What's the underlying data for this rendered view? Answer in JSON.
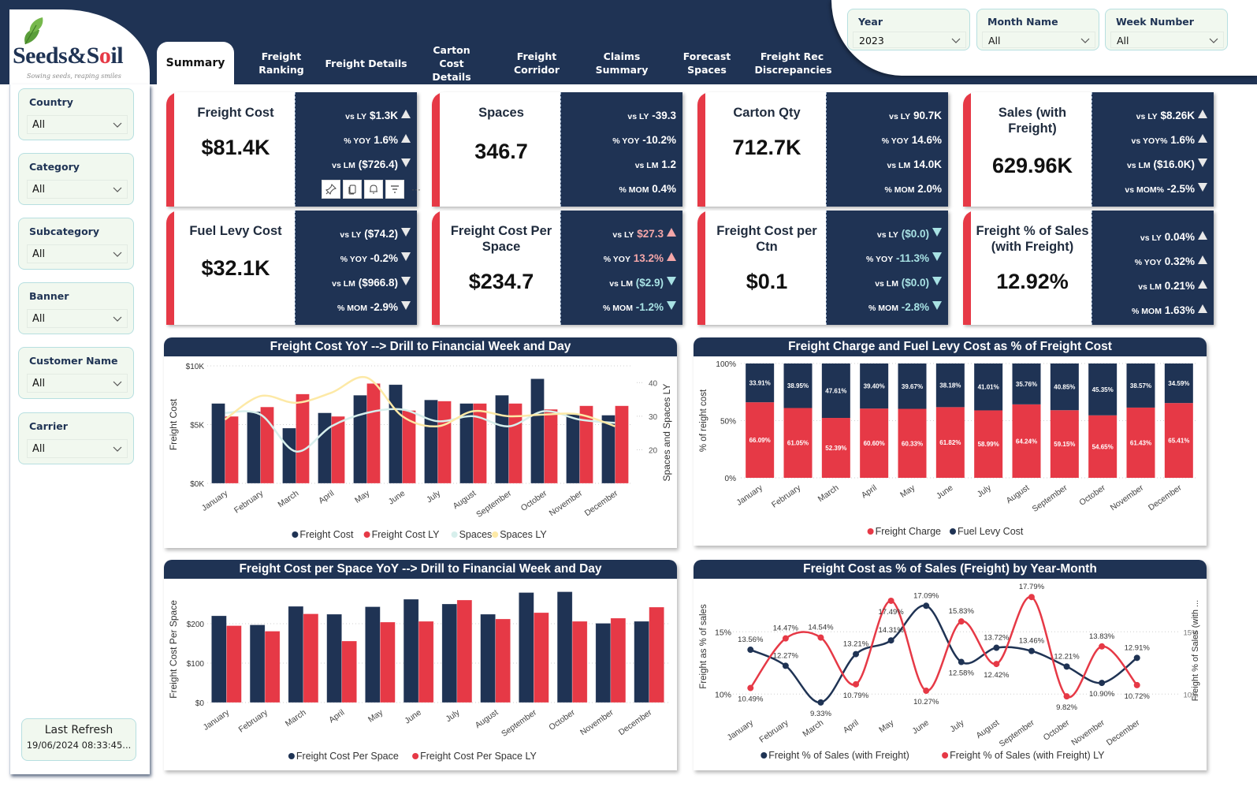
{
  "brand": {
    "name_part1": "Seeds&S",
    "name_o": "o",
    "name_part2": "il",
    "tagline": "Sowing seeds, reaping smiles"
  },
  "colors": {
    "navy": "#1f3354",
    "red": "#e63946",
    "mint": "#f1f8ef",
    "spaces": "#d7efec",
    "spaces_ly": "#fde9a6",
    "pink_up": "#f4a6a8",
    "teal_down": "#a8e2e4"
  },
  "tabs": [
    {
      "label": "Summary",
      "active": true
    },
    {
      "label": "Freight Ranking"
    },
    {
      "label": "Freight Details"
    },
    {
      "label": "Carton Cost Details"
    },
    {
      "label": "Freight Corridor"
    },
    {
      "label": "Claims Summary"
    },
    {
      "label": "Forecast Spaces"
    },
    {
      "label": "Freight Rec Discrepancies"
    }
  ],
  "header_filters": [
    {
      "label": "Year",
      "value": "2023"
    },
    {
      "label": "Month Name",
      "value": "All"
    },
    {
      "label": "Week Number",
      "value": "All"
    }
  ],
  "sidebar_filters": [
    {
      "label": "Country",
      "value": "All"
    },
    {
      "label": "Category",
      "value": "All"
    },
    {
      "label": "Subcategory",
      "value": "All"
    },
    {
      "label": "Banner",
      "value": "All"
    },
    {
      "label": "Customer Name",
      "value": "All"
    },
    {
      "label": "Carrier",
      "value": "All"
    }
  ],
  "last_refresh": {
    "label": "Last Refresh",
    "value": "19/06/2024 08:33:45..."
  },
  "visual_toolbar": {
    "icons": [
      "pin-icon",
      "copy-icon",
      "bell-icon",
      "filter-icon",
      "more-options-icon"
    ],
    "more": "···"
  },
  "kpis": [
    {
      "title": "Freight Cost",
      "value": "$81.4K",
      "rows": [
        {
          "pre": "vs LY",
          "val": "$1.3K",
          "arrow": "up"
        },
        {
          "pre": "% YOY",
          "val": "1.6%",
          "arrow": "up"
        },
        {
          "pre": "vs LM",
          "val": "($726.4)",
          "arrow": "down"
        }
      ]
    },
    {
      "title": "Spaces",
      "value": "346.7",
      "rows": [
        {
          "pre": "vs LY",
          "val": "-39.3"
        },
        {
          "pre": "% YOY",
          "val": "-10.2%"
        },
        {
          "pre": "vs LM",
          "val": "1.2"
        },
        {
          "pre": "% MOM",
          "val": "0.4%"
        }
      ]
    },
    {
      "title": "Carton Qty",
      "value": "712.7K",
      "rows": [
        {
          "pre": "vs LY",
          "val": "90.7K"
        },
        {
          "pre": "% YOY",
          "val": "14.6%"
        },
        {
          "pre": "vs LM",
          "val": "14.0K"
        },
        {
          "pre": "% MOM",
          "val": "2.0%"
        }
      ]
    },
    {
      "title": "Sales (with Freight)",
      "value": "629.96K",
      "rows": [
        {
          "pre": "vs LY",
          "val": "$8.26K",
          "arrow": "up"
        },
        {
          "pre": "vs YOY%",
          "val": "1.6%",
          "arrow": "up"
        },
        {
          "pre": "vs LM",
          "val": "($16.0K)",
          "arrow": "down"
        },
        {
          "pre": "vs MOM%",
          "val": "-2.5%",
          "arrow": "down"
        }
      ]
    },
    {
      "title": "Fuel Levy Cost",
      "value": "$32.1K",
      "rows": [
        {
          "pre": "vs LY",
          "val": "($74.2)",
          "arrow": "down"
        },
        {
          "pre": "% YOY",
          "val": "-0.2%",
          "arrow": "down"
        },
        {
          "pre": "vs LM",
          "val": "($966.8)",
          "arrow": "down"
        },
        {
          "pre": "% MOM",
          "val": "-2.9%",
          "arrow": "down"
        }
      ]
    },
    {
      "title": "Freight Cost Per Space",
      "value": "$234.7",
      "rows": [
        {
          "pre": "vs LY",
          "val": "$27.3",
          "arrow": "up",
          "tone": "pink"
        },
        {
          "pre": "% YOY",
          "val": "13.2%",
          "arrow": "up",
          "tone": "pink"
        },
        {
          "pre": "vs LM",
          "val": "($2.9)",
          "arrow": "down",
          "tone": "teal"
        },
        {
          "pre": "% MOM",
          "val": "-1.2%",
          "arrow": "down",
          "tone": "teal"
        }
      ]
    },
    {
      "title": "Freight Cost per Ctn",
      "value": "$0.1",
      "rows": [
        {
          "pre": "vs LY",
          "val": "($0.0)",
          "arrow": "down",
          "tone": "teal"
        },
        {
          "pre": "% YOY",
          "val": "-11.3%",
          "arrow": "down",
          "tone": "teal"
        },
        {
          "pre": "vs LM",
          "val": "($0.0)",
          "arrow": "down",
          "tone": "teal"
        },
        {
          "pre": "% MOM",
          "val": "-2.8%",
          "arrow": "down",
          "tone": "teal"
        }
      ]
    },
    {
      "title": "Freight % of Sales (with Freight)",
      "value": "12.92%",
      "rows": [
        {
          "pre": "vs LY",
          "val": "0.04%",
          "arrow": "up"
        },
        {
          "pre": "% YOY",
          "val": "0.32%",
          "arrow": "up"
        },
        {
          "pre": "vs LM",
          "val": "0.21%",
          "arrow": "up"
        },
        {
          "pre": "% MOM",
          "val": "1.63%",
          "arrow": "up"
        }
      ]
    }
  ],
  "chart_data": [
    {
      "id": "freight-cost-yoy",
      "type": "bar",
      "title": "Freight Cost YoY --> Drill to Financial Week and Day",
      "categories": [
        "January",
        "February",
        "March",
        "April",
        "May",
        "June",
        "July",
        "August",
        "September",
        "October",
        "November",
        "December"
      ],
      "ylabel": "Freight Cost",
      "y2label": "Spaces and Spaces LY",
      "ylim": [
        0,
        10000
      ],
      "y2lim": [
        10,
        45
      ],
      "yticks": [
        "$0K",
        "$5K",
        "$10K"
      ],
      "y2ticks": [
        "20",
        "30",
        "40"
      ],
      "series": [
        {
          "name": "Freight Cost",
          "kind": "bar",
          "color": "#1f3354",
          "values": [
            6800,
            6100,
            4700,
            6000,
            7500,
            8400,
            7100,
            6800,
            7500,
            8900,
            5900,
            5800
          ]
        },
        {
          "name": "Freight Cost LY",
          "kind": "bar",
          "color": "#e63946",
          "values": [
            5700,
            6500,
            7600,
            5700,
            8500,
            6200,
            7000,
            6800,
            6800,
            6300,
            6600,
            6600
          ]
        },
        {
          "name": "Spaces",
          "kind": "line",
          "axis": "y2",
          "color": "#d7efec",
          "values": [
            31,
            30.5,
            19.5,
            27,
            31,
            32,
            28.5,
            30,
            27,
            31.5,
            29,
            28
          ]
        },
        {
          "name": "Spaces LY",
          "kind": "line",
          "axis": "y2",
          "color": "#fde9a6",
          "values": [
            29,
            36,
            34,
            37,
            41.5,
            30,
            27,
            31.5,
            30,
            30.5,
            30.5,
            27
          ]
        }
      ],
      "legend": "bottom",
      "grid": true
    },
    {
      "id": "freight-charge-fuel-levy",
      "type": "bar",
      "stacked": true,
      "title": "Freight Charge and Fuel Levy Cost as % of Freight Cost",
      "categories": [
        "January",
        "February",
        "March",
        "April",
        "May",
        "June",
        "July",
        "August",
        "September",
        "October",
        "November",
        "December"
      ],
      "ylabel": "% of reight cost",
      "ylim": [
        0,
        100
      ],
      "yticks": [
        "0%",
        "50%",
        "100%"
      ],
      "series": [
        {
          "name": "Freight Charge",
          "color": "#e63946",
          "values": [
            66.09,
            61.05,
            52.39,
            60.6,
            60.33,
            61.82,
            58.99,
            64.24,
            59.15,
            54.65,
            61.43,
            65.41
          ],
          "labels": [
            "66.09%",
            "61.05%",
            "52.39%",
            "60.60%",
            "60.33%",
            "61.82%",
            "58.99%",
            "64.24%",
            "59.15%",
            "54.65%",
            "61.43%",
            "65.41%"
          ]
        },
        {
          "name": "Fuel Levy Cost",
          "color": "#1f3354",
          "values": [
            33.91,
            38.95,
            47.61,
            39.4,
            39.67,
            38.18,
            41.01,
            35.76,
            40.85,
            45.35,
            38.57,
            34.59
          ],
          "labels": [
            "33.91%",
            "38.95%",
            "47.61%",
            "39.40%",
            "39.67%",
            "38.18%",
            "41.01%",
            "35.76%",
            "40.85%",
            "45.35%",
            "38.57%",
            "34.59%"
          ]
        }
      ],
      "legend": "bottom",
      "grid": true
    },
    {
      "id": "freight-cost-per-space-yoy",
      "type": "bar",
      "title": "Freight Cost per Space YoY --> Drill to Financial Week and Day",
      "categories": [
        "January",
        "February",
        "March",
        "April",
        "May",
        "June",
        "July",
        "August",
        "September",
        "October",
        "November",
        "December"
      ],
      "ylabel": "Freight Cost Per Space",
      "ylim": [
        0,
        290
      ],
      "yticks": [
        "$0",
        "$100",
        "$200"
      ],
      "ytick_values": [
        0,
        100,
        200
      ],
      "series": [
        {
          "name": "Freight Cost Per Space",
          "color": "#1f3354",
          "values": [
            220,
            197,
            244,
            224,
            243,
            262,
            250,
            224,
            279,
            281,
            201,
            206
          ]
        },
        {
          "name": "Freight Cost Per Space LY",
          "color": "#e63946",
          "values": [
            195,
            181,
            225,
            156,
            204,
            206,
            260,
            212,
            228,
            206,
            214,
            242
          ]
        }
      ],
      "legend": "bottom",
      "grid": true
    },
    {
      "id": "freight-cost-pct-sales",
      "type": "line",
      "title": "Freight Cost as % of Sales (Freight) by Year-Month",
      "categories": [
        "January",
        "February",
        "March",
        "April",
        "May",
        "June",
        "July",
        "August",
        "September",
        "October",
        "November",
        "December"
      ],
      "ylabel": "Freight as % of sales",
      "y2label": "Freight % of Sales (with ...",
      "ylim": [
        8.5,
        18.5
      ],
      "yticks": [
        "10%",
        "15%"
      ],
      "ytick_values": [
        10,
        15
      ],
      "series": [
        {
          "name": "Freight % of Sales (with Freight)",
          "color": "#1f3354",
          "values": [
            13.56,
            12.27,
            9.33,
            13.21,
            14.31,
            17.09,
            12.58,
            13.72,
            13.46,
            12.21,
            10.9,
            12.91
          ],
          "labels": [
            "13.56%",
            "12.27%",
            "9.33%",
            "13.21%",
            "14.31%",
            "17.09%",
            "12.58%",
            "13.72%",
            "13.46%",
            "12.21%",
            "10.90%",
            "12.91%"
          ]
        },
        {
          "name": "Freight % of Sales (with Freight) LY",
          "color": "#e63946",
          "values": [
            10.49,
            14.47,
            14.54,
            10.79,
            17.49,
            10.27,
            15.83,
            12.42,
            17.79,
            9.82,
            13.83,
            10.72
          ],
          "labels": [
            "10.49%",
            "14.47%",
            "14.54%",
            "10.79%",
            "17.49%",
            "10.27%",
            "15.83%",
            "12.42%",
            "17.79%",
            "9.82%",
            "13.83%",
            "10.72%"
          ]
        }
      ],
      "legend": "bottom",
      "grid": true
    }
  ]
}
